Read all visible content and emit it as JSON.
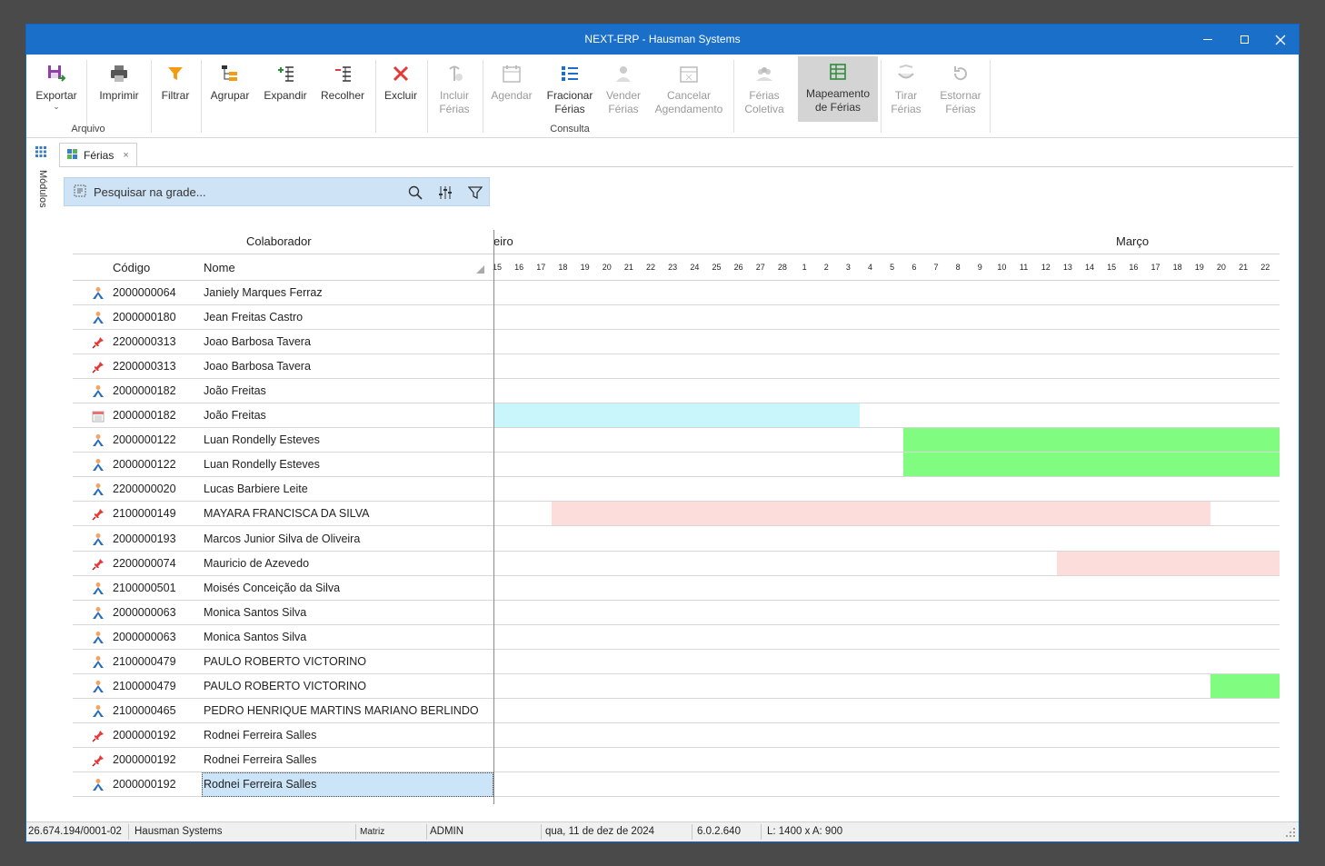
{
  "window": {
    "title": "NEXT-ERP - Hausman Systems"
  },
  "ribbon": {
    "exportar": "Exportar",
    "imprimir": "Imprimir",
    "group_arquivo": "Arquivo",
    "filtrar": "Filtrar",
    "agrupar": "Agrupar",
    "expandir": "Expandir",
    "recolher": "Recolher",
    "excluir": "Excluir",
    "incluir_1": "Incluir",
    "incluir_2": "Férias",
    "agendar": "Agendar",
    "fracionar_1": "Fracionar",
    "fracionar_2": "Férias",
    "group_consulta": "Consulta",
    "vender_1": "Vender",
    "vender_2": "Férias",
    "cancelar_1": "Cancelar",
    "cancelar_2": "Agendamento",
    "coletiva_1": "Férias",
    "coletiva_2": "Coletiva",
    "mapeamento_1": "Mapeamento",
    "mapeamento_2": "de Férias",
    "tirar_1": "Tirar",
    "tirar_2": "Férias",
    "estornar_1": "Estornar",
    "estornar_2": "Férias"
  },
  "tabs": {
    "active": "Férias",
    "sidebar": "Módulos"
  },
  "search": {
    "placeholder": "Pesquisar na grade..."
  },
  "grid": {
    "group_header": "Colaborador",
    "col_code": "Código",
    "col_name": "Nome",
    "month_left": "eiro",
    "month_right": "Março",
    "days": [
      "15",
      "16",
      "17",
      "18",
      "19",
      "20",
      "21",
      "22",
      "23",
      "24",
      "25",
      "26",
      "27",
      "28",
      "1",
      "2",
      "3",
      "4",
      "5",
      "6",
      "7",
      "8",
      "9",
      "10",
      "11",
      "12",
      "13",
      "14",
      "15",
      "16",
      "17",
      "18",
      "19",
      "20",
      "21",
      "22"
    ],
    "first_day_label": "15",
    "rows": [
      {
        "icon": "person-icon",
        "code": "2000000064",
        "name": "Janiely Marques Ferraz"
      },
      {
        "icon": "person-icon",
        "code": "2000000180",
        "name": "Jean Freitas Castro"
      },
      {
        "icon": "pin-icon",
        "code": "2200000313",
        "name": "Joao Barbosa Tavera"
      },
      {
        "icon": "pin-icon",
        "code": "2200000313",
        "name": "Joao Barbosa Tavera"
      },
      {
        "icon": "person-icon",
        "code": "2000000182",
        "name": "João Freitas"
      },
      {
        "icon": "calendar-icon",
        "code": "2000000182",
        "name": "João Freitas",
        "bar": {
          "from": "15",
          "to": "3",
          "color": "#c8f6fb"
        }
      },
      {
        "icon": "person-icon",
        "code": "2000000122",
        "name": "Luan Rondelly Esteves",
        "bar": {
          "from": "6",
          "to": "22",
          "color": "#80fc80"
        }
      },
      {
        "icon": "person-icon",
        "code": "2000000122",
        "name": "Luan Rondelly Esteves",
        "bar": {
          "from": "6",
          "to": "22",
          "color": "#80fc80"
        }
      },
      {
        "icon": "person-icon",
        "code": "2200000020",
        "name": "Lucas Barbiere Leite"
      },
      {
        "icon": "pin-icon",
        "code": "2100000149",
        "name": "MAYARA FRANCISCA DA SILVA",
        "bar": {
          "from": "18",
          "to": "19",
          "color": "#fddcdc"
        }
      },
      {
        "icon": "person-icon",
        "code": "2000000193",
        "name": "Marcos Junior Silva de Oliveira"
      },
      {
        "icon": "pin-icon",
        "code": "2200000074",
        "name": "Mauricio de Azevedo",
        "bar": {
          "from": "13",
          "to": "22",
          "color": "#fddcdc"
        }
      },
      {
        "icon": "person-icon",
        "code": "2100000501",
        "name": "Moisés Conceição da Silva"
      },
      {
        "icon": "person-icon",
        "code": "2000000063",
        "name": "Monica Santos Silva"
      },
      {
        "icon": "person-icon",
        "code": "2000000063",
        "name": "Monica Santos Silva"
      },
      {
        "icon": "person-icon",
        "code": "2100000479",
        "name": "PAULO ROBERTO VICTORINO"
      },
      {
        "icon": "person-icon",
        "code": "2100000479",
        "name": "PAULO ROBERTO VICTORINO",
        "bar": {
          "from": "20",
          "to": "22",
          "color": "#80fc80"
        }
      },
      {
        "icon": "person-icon",
        "code": "2100000465",
        "name": "PEDRO HENRIQUE MARTINS MARIANO BERLINDO"
      },
      {
        "icon": "pin-icon",
        "code": "2000000192",
        "name": "Rodnei Ferreira Salles"
      },
      {
        "icon": "pin-icon",
        "code": "2000000192",
        "name": "Rodnei Ferreira Salles"
      },
      {
        "icon": "person-icon",
        "code": "2000000192",
        "name": "Rodnei Ferreira Salles",
        "selected": true
      }
    ]
  },
  "statusbar": {
    "cnpj": "26.674.194/0001-02",
    "company": "Hausman Systems",
    "branch": "Matriz",
    "user": "ADMIN",
    "date": "qua, 11 de dez de 2024",
    "version": "6.0.2.640",
    "size": "L: 1400 x A: 900"
  },
  "colors": {
    "titlebar": "#1a6fc9",
    "search_bg": "#cfe3f6",
    "selection": "#cce4f7"
  }
}
